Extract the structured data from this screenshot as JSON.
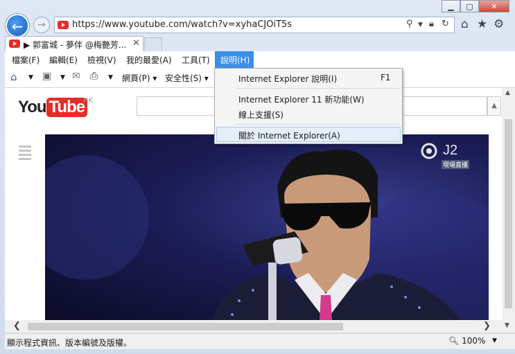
{
  "address": {
    "url": "https://www.youtube.com/watch?v=xyhaCJOiT5s"
  },
  "tab": {
    "title": "▶ 郭富城 - 夢伴 @梅艷芳..."
  },
  "menubar": {
    "items": [
      "檔案(F)",
      "編輯(E)",
      "檢視(V)",
      "我的最愛(A)",
      "工具(T)",
      "說明(H)"
    ]
  },
  "commandbar": {
    "page": "網頁(P)",
    "safety": "安全性(S)"
  },
  "help_menu": {
    "items": [
      {
        "label": "Internet Explorer 說明(I)",
        "shortcut": "F1"
      },
      {
        "label": "Internet Explorer 11 新功能(W)",
        "shortcut": ""
      },
      {
        "label": "線上支援(S)",
        "shortcut": ""
      },
      {
        "label": "關於 Internet Explorer(A)",
        "shortcut": ""
      }
    ]
  },
  "youtube": {
    "logo_you": "You",
    "logo_tube": "Tube",
    "region": "HK"
  },
  "video": {
    "channel_logo": "J2",
    "channel_sub": "現場直播"
  },
  "statusbar": {
    "text": "顯示程式資訊、版本編號及版權。",
    "zoom": "100%"
  }
}
